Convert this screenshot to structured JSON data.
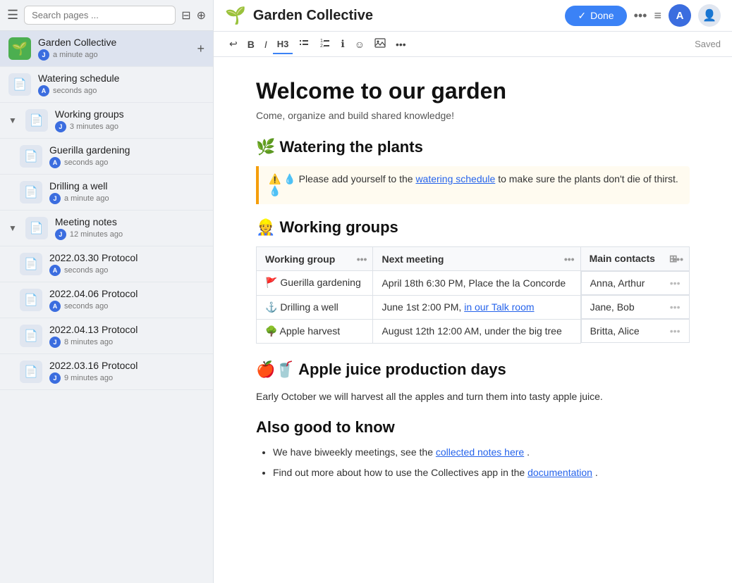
{
  "sidebar": {
    "search_placeholder": "Search pages ...",
    "items": [
      {
        "id": "garden-collective",
        "title": "Garden Collective",
        "time": "a minute ago",
        "avatar_letter": "J",
        "avatar_color": "green",
        "icon": "🌱",
        "icon_type": "emoji",
        "active": true,
        "has_plus": true
      },
      {
        "id": "watering-schedule",
        "title": "Watering schedule",
        "time": "seconds ago",
        "avatar_letter": "A",
        "avatar_color": "blue",
        "icon": "doc",
        "icon_type": "doc"
      },
      {
        "id": "working-groups",
        "title": "Working groups",
        "time": "3 minutes ago",
        "avatar_letter": "J",
        "avatar_color": "blue",
        "icon": "doc",
        "icon_type": "doc",
        "has_collapse": true
      },
      {
        "id": "guerilla-gardening",
        "title": "Guerilla gardening",
        "time": "seconds ago",
        "avatar_letter": "A",
        "avatar_color": "blue",
        "icon": "doc",
        "icon_type": "doc",
        "sub": true
      },
      {
        "id": "drilling-a-well",
        "title": "Drilling a well",
        "time": "a minute ago",
        "avatar_letter": "J",
        "avatar_color": "blue",
        "icon": "doc",
        "icon_type": "doc",
        "sub": true
      },
      {
        "id": "meeting-notes",
        "title": "Meeting notes",
        "time": "12 minutes ago",
        "avatar_letter": "J",
        "avatar_color": "blue",
        "icon": "doc",
        "icon_type": "doc",
        "has_collapse": true
      },
      {
        "id": "protocol-20220330",
        "title": "2022.03.30 Protocol",
        "time": "seconds ago",
        "avatar_letter": "A",
        "avatar_color": "blue",
        "icon": "doc",
        "icon_type": "doc",
        "sub": true
      },
      {
        "id": "protocol-20220406",
        "title": "2022.04.06 Protocol",
        "time": "seconds ago",
        "avatar_letter": "A",
        "avatar_color": "blue",
        "icon": "doc",
        "icon_type": "doc",
        "sub": true
      },
      {
        "id": "protocol-20220413",
        "title": "2022.04.13 Protocol",
        "time": "8 minutes ago",
        "avatar_letter": "J",
        "avatar_color": "blue",
        "icon": "doc",
        "icon_type": "doc",
        "sub": true
      },
      {
        "id": "protocol-20220316",
        "title": "2022.03.16 Protocol",
        "time": "9 minutes ago",
        "avatar_letter": "J",
        "avatar_color": "blue",
        "icon": "doc",
        "icon_type": "doc",
        "sub": true
      }
    ]
  },
  "topbar": {
    "page_icon": "🌱",
    "page_title": "Garden Collective",
    "done_label": "Done",
    "saved_label": "Saved",
    "avatar_letter": "A"
  },
  "toolbar": {
    "undo": "↩",
    "bold": "B",
    "italic": "I",
    "h3": "H3",
    "bullet": "≡",
    "numbered": "≣",
    "info": "ℹ",
    "emoji": "☺",
    "image": "⊡",
    "more": "•••"
  },
  "doc": {
    "title": "Welcome to our garden",
    "subtitle": "Come, organize and build shared knowledge!",
    "sections": [
      {
        "id": "watering",
        "heading": "🌿 Watering the plants",
        "callout": {
          "icon_warning": "⚠️",
          "icon_water": "💧",
          "text_before": "Please add yourself to the ",
          "link_text": "watering schedule",
          "text_after": " to make sure the plants don't die of thirst.",
          "icon_end": "💧"
        }
      },
      {
        "id": "working-groups",
        "heading": "👷 Working groups",
        "table": {
          "columns": [
            "Working group",
            "Next meeting",
            "Main contacts"
          ],
          "rows": [
            {
              "group": "🚩 Guerilla gardening",
              "next_meeting": "April 18th 6:30 PM, Place the la Concorde",
              "contacts": "Anna, Arthur"
            },
            {
              "group": "⚓ Drilling a well",
              "next_meeting_before": "June 1st 2:00 PM, ",
              "next_meeting_link": "in our Talk room",
              "next_meeting_after": "",
              "contacts": "Jane, Bob"
            },
            {
              "group": "🌳 Apple harvest",
              "next_meeting": "August 12th 12:00 AM, under the big tree",
              "contacts": "Britta, Alice"
            }
          ]
        }
      },
      {
        "id": "apple-juice",
        "heading": "🍎🥤 Apple juice production days",
        "body": "Early October we will harvest all the apples and turn them into tasty apple juice."
      },
      {
        "id": "also-good",
        "heading": "Also good to know",
        "bullets": [
          {
            "text_before": "We have biweekly meetings, see the ",
            "link_text": "collected notes here",
            "text_after": "."
          },
          {
            "text_before": "Find out more about how to use the Collectives app in the ",
            "link_text": "documentation",
            "text_after": "."
          }
        ]
      }
    ]
  }
}
